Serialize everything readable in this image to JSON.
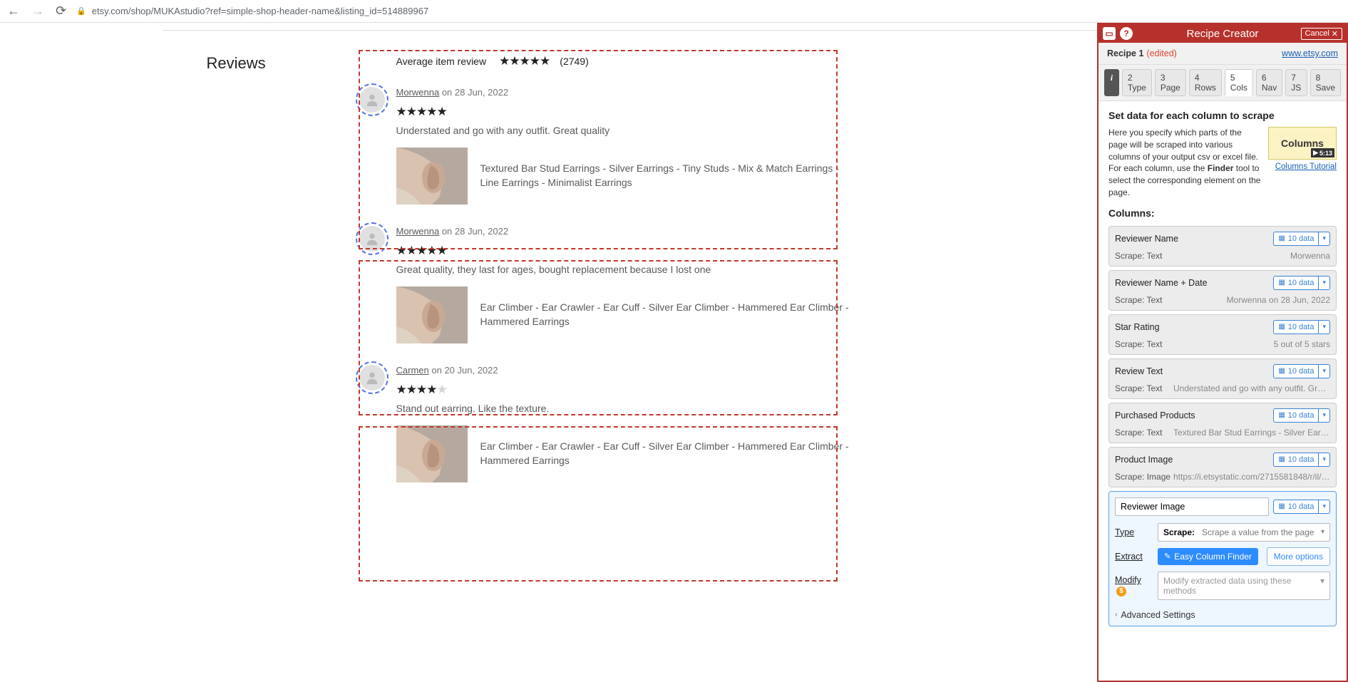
{
  "browser": {
    "url": "etsy.com/shop/MUKAstudio?ref=simple-shop-header-name&listing_id=514889967"
  },
  "page": {
    "section_heading": "Reviews",
    "avg_label": "Average item review",
    "avg_count": "(2749)",
    "reviews": [
      {
        "name": "Morwenna",
        "date": "on 28 Jun, 2022",
        "stars": 5,
        "text": "Understated and go with any outfit. Great quality",
        "product": "Textured Bar Stud Earrings - Silver Earrings - Tiny Studs - Mix & Match Earrings - Line Earrings - Minimalist Earrings"
      },
      {
        "name": "Morwenna",
        "date": "on 28 Jun, 2022",
        "stars": 5,
        "text": "Great quality, they last for ages, bought replacement because I lost one",
        "product": "Ear Climber - Ear Crawler - Ear Cuff - Silver Ear Climber - Hammered Ear Climber - Hammered Earrings"
      },
      {
        "name": "Carmen",
        "date": "on 20 Jun, 2022",
        "stars": 4,
        "text": "Stand out earring. Like the texture.",
        "product": "Ear Climber - Ear Crawler - Ear Cuff - Silver Ear Climber - Hammered Ear Climber - Hammered Earrings"
      }
    ]
  },
  "panel": {
    "title": "Recipe Creator",
    "cancel": "Cancel",
    "recipe_name": "Recipe 1",
    "edited": "(edited)",
    "source_link": "www.etsy.com",
    "tabs": [
      "2 Type",
      "3 Page",
      "4 Rows",
      "5 Cols",
      "6 Nav",
      "7 JS",
      "8 Save"
    ],
    "body_heading": "Set data for each column to scrape",
    "intro_a": "Here you specify which parts of the page will be scraped into various columns of your output csv or excel file. For each column, use the ",
    "intro_b": "Finder",
    "intro_c": " tool to select the corresponding element on the page.",
    "video_label": "Columns",
    "video_time": "5:13",
    "tutorial_link": "Columns Tutorial",
    "columns_heading": "Columns:",
    "badge": "10 data",
    "cols": [
      {
        "name": "Reviewer Name",
        "scrape": "Scrape: Text",
        "sample": "Morwenna"
      },
      {
        "name": "Reviewer Name + Date",
        "scrape": "Scrape: Text",
        "sample": "Morwenna on 28 Jun, 2022"
      },
      {
        "name": "Star Rating",
        "scrape": "Scrape: Text",
        "sample": "5 out of 5 stars"
      },
      {
        "name": "Review Text",
        "scrape": "Scrape: Text",
        "sample": "Understated and go with any outfit. Great quality"
      },
      {
        "name": "Purchased Products",
        "scrape": "Scrape: Text",
        "sample": "Textured Bar Stud Earrings - Silver Earrings - Tiny..."
      },
      {
        "name": "Product Image",
        "scrape": "Scrape: Image",
        "sample": "https://i.etsystatic.com/2715581848/r/il/0610f9/2..."
      }
    ],
    "new_col_name": "Reviewer Image",
    "type_label": "Type",
    "scrape_sel_label": "Scrape:",
    "scrape_sel_text": "Scrape a value from the page",
    "extract_label": "Extract",
    "easy_btn": "Easy Column Finder",
    "more_options": "More options",
    "modify_label": "Modify",
    "modify_placeholder": "Modify extracted data using these methods",
    "advanced": "Advanced Settings"
  }
}
